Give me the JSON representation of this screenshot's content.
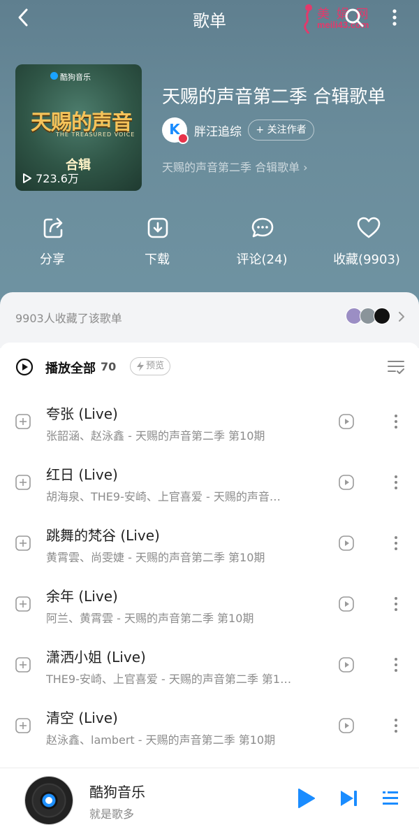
{
  "header": {
    "title": "歌单",
    "watermark_top": "美 娟 网",
    "watermark_bottom": "meili43.com"
  },
  "cover": {
    "brand": "酷狗音乐",
    "logo_text": "天赐的声音",
    "logo_sub": "THE TREASURED VOICE",
    "album_label": "合辑",
    "play_count": "723.6万"
  },
  "playlist": {
    "title": "天赐的声音第二季 合辑歌单",
    "author_initial": "K",
    "author_name": "胖汪追综",
    "follow_label": "+ 关注作者",
    "description": "天赐的声音第二季 合辑歌单 ›"
  },
  "actions": {
    "share": "分享",
    "download": "下载",
    "comment": "评论(24)",
    "collect": "收藏(9903)"
  },
  "favorites": {
    "text": "9903人收藏了该歌单"
  },
  "list": {
    "play_all": "播放全部",
    "count": "70",
    "preview": "预览"
  },
  "songs": [
    {
      "title": "夸张 (Live)",
      "meta": "张韶涵、赵泳鑫 - 天赐的声音第二季 第10期"
    },
    {
      "title": "红日 (Live)",
      "meta": "胡海泉、THE9-安崎、上官喜爱 - 天赐的声音…"
    },
    {
      "title": "跳舞的梵谷 (Live)",
      "meta": "黄霄雲、尚雯婕 - 天赐的声音第二季 第10期"
    },
    {
      "title": "余年 (Live)",
      "meta": "阿兰、黄霄雲 - 天赐的声音第二季 第10期"
    },
    {
      "title": "潇洒小姐 (Live)",
      "meta": "THE9-安崎、上官喜爱 - 天赐的声音第二季 第1…"
    },
    {
      "title": "清空 (Live)",
      "meta": "赵泳鑫、lambert - 天赐的声音第二季 第10期"
    }
  ],
  "player": {
    "title": "酷狗音乐",
    "subtitle": "就是歌多"
  },
  "colors": {
    "accent": "#1a8cff",
    "hero_bg": "#6a8c9b"
  }
}
